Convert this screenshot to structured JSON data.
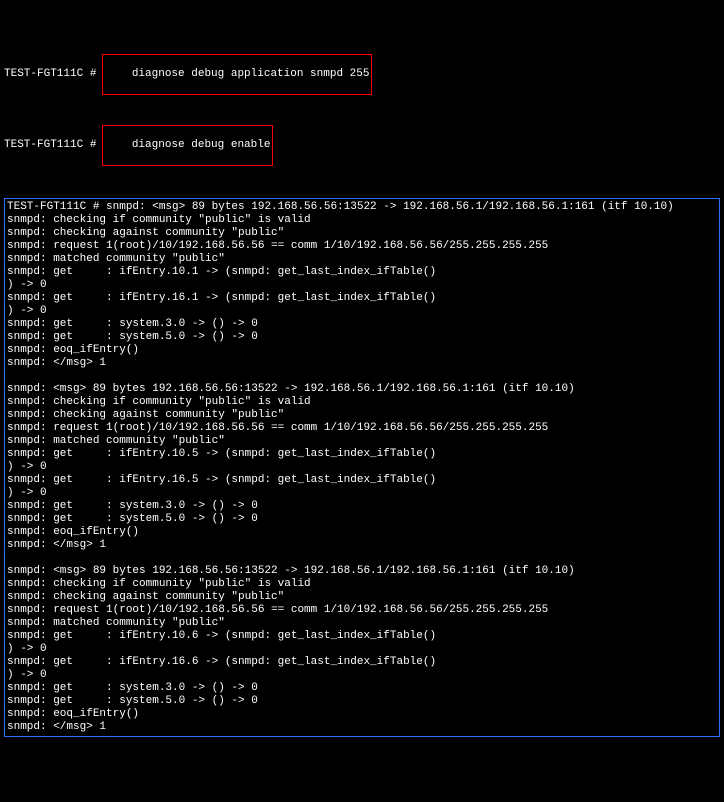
{
  "prompt": "TEST-FGT111C #",
  "cmd1": "diagnose debug application snmpd 255",
  "cmd2": "diagnose debug enable",
  "output": [
    "TEST-FGT111C # snmpd: <msg> 89 bytes 192.168.56.56:13522 -> 192.168.56.1/192.168.56.1:161 (itf 10.10)",
    "snmpd: checking if community \"public\" is valid",
    "snmpd: checking against community \"public\"",
    "snmpd: request 1(root)/10/192.168.56.56 == comm 1/10/192.168.56.56/255.255.255.255",
    "snmpd: matched community \"public\"",
    "snmpd: get     : ifEntry.10.1 -> (snmpd: get_last_index_ifTable()",
    ") -> 0",
    "snmpd: get     : ifEntry.16.1 -> (snmpd: get_last_index_ifTable()",
    ") -> 0",
    "snmpd: get     : system.3.0 -> () -> 0",
    "snmpd: get     : system.5.0 -> () -> 0",
    "snmpd: eoq_ifEntry()",
    "snmpd: </msg> 1",
    "",
    "snmpd: <msg> 89 bytes 192.168.56.56:13522 -> 192.168.56.1/192.168.56.1:161 (itf 10.10)",
    "snmpd: checking if community \"public\" is valid",
    "snmpd: checking against community \"public\"",
    "snmpd: request 1(root)/10/192.168.56.56 == comm 1/10/192.168.56.56/255.255.255.255",
    "snmpd: matched community \"public\"",
    "snmpd: get     : ifEntry.10.5 -> (snmpd: get_last_index_ifTable()",
    ") -> 0",
    "snmpd: get     : ifEntry.16.5 -> (snmpd: get_last_index_ifTable()",
    ") -> 0",
    "snmpd: get     : system.3.0 -> () -> 0",
    "snmpd: get     : system.5.0 -> () -> 0",
    "snmpd: eoq_ifEntry()",
    "snmpd: </msg> 1",
    "",
    "snmpd: <msg> 89 bytes 192.168.56.56:13522 -> 192.168.56.1/192.168.56.1:161 (itf 10.10)",
    "snmpd: checking if community \"public\" is valid",
    "snmpd: checking against community \"public\"",
    "snmpd: request 1(root)/10/192.168.56.56 == comm 1/10/192.168.56.56/255.255.255.255",
    "snmpd: matched community \"public\"",
    "snmpd: get     : ifEntry.10.6 -> (snmpd: get_last_index_ifTable()",
    ") -> 0",
    "snmpd: get     : ifEntry.16.6 -> (snmpd: get_last_index_ifTable()",
    ") -> 0",
    "snmpd: get     : system.3.0 -> () -> 0",
    "snmpd: get     : system.5.0 -> () -> 0",
    "snmpd: eoq_ifEntry()",
    "snmpd: </msg> 1"
  ]
}
